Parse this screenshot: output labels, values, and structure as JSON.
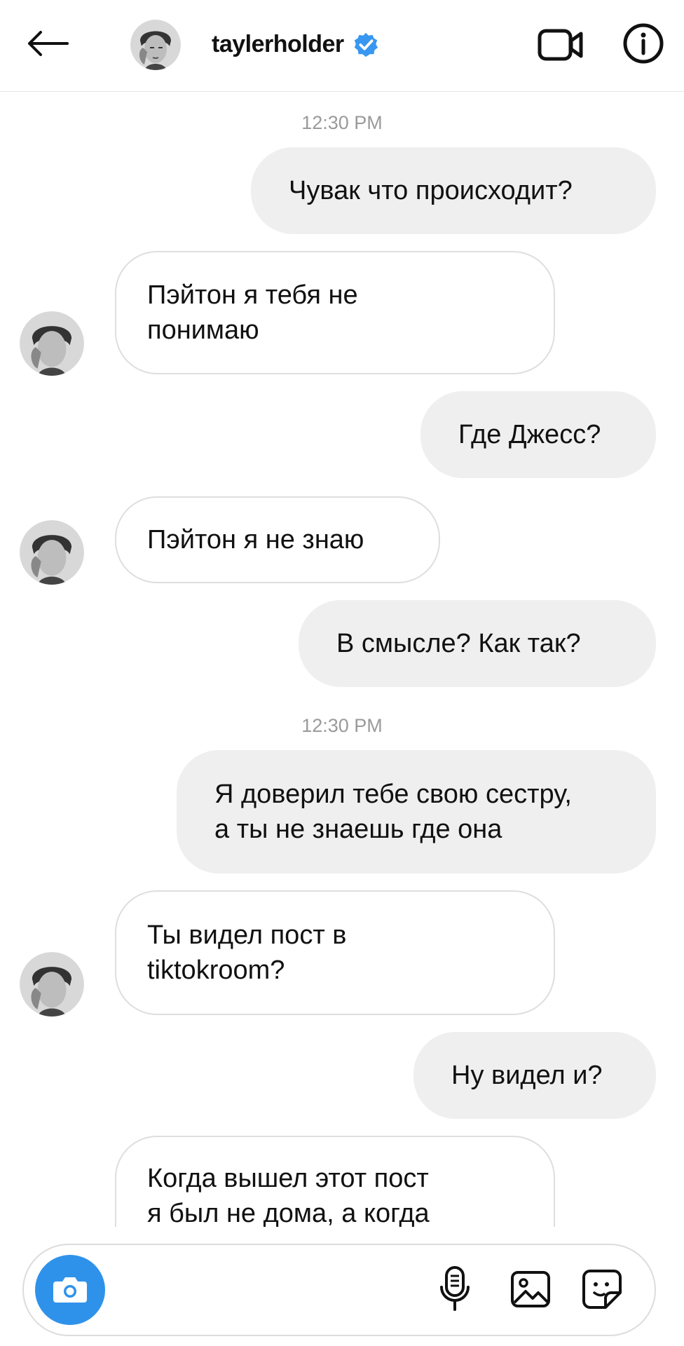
{
  "header": {
    "username": "taylerholder",
    "verified": true,
    "back_icon": "arrow-left-icon",
    "video_icon": "video-camera-icon",
    "info_icon": "info-icon"
  },
  "messages": [
    {
      "type": "timestamp",
      "text": "12:30 PM"
    },
    {
      "type": "outgoing",
      "lines": [
        "Чувак что происходит?"
      ]
    },
    {
      "type": "incoming",
      "lines": [
        "Пэйтон я тебя не",
        "понимаю"
      ]
    },
    {
      "type": "outgoing",
      "lines": [
        "Где Джесс?"
      ]
    },
    {
      "type": "incoming",
      "lines": [
        "Пэйтон я не знаю"
      ]
    },
    {
      "type": "outgoing",
      "lines": [
        "В смысле? Как так?"
      ]
    },
    {
      "type": "timestamp",
      "text": "12:30 PM"
    },
    {
      "type": "outgoing",
      "lines": [
        "Я доверил тебе свою сестру,",
        "а ты не знаешь где она"
      ]
    },
    {
      "type": "incoming",
      "lines": [
        "Ты видел пост в",
        "tiktokroom?"
      ]
    },
    {
      "type": "outgoing",
      "lines": [
        "Ну видел и?"
      ]
    },
    {
      "type": "incoming",
      "lines": [
        "Когда вышел этот пост",
        "я был не дома, а когда"
      ]
    }
  ],
  "composer": {
    "placeholder": "",
    "camera_icon": "camera-icon",
    "mic_icon": "microphone-icon",
    "gallery_icon": "gallery-icon",
    "sticker_icon": "sticker-icon"
  },
  "colors": {
    "accent": "#2f92ea",
    "verified": "#3897f0",
    "outgoing_bubble": "#efefef",
    "timestamp": "#9a9a9a"
  }
}
